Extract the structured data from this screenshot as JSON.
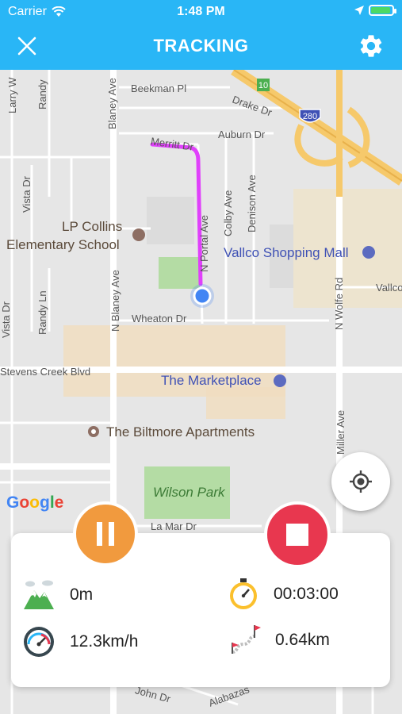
{
  "status": {
    "carrier": "Carrier",
    "time": "1:48 PM"
  },
  "navbar": {
    "title": "TRACKING"
  },
  "map": {
    "labels": {
      "beekman": "Beekman Pl",
      "drake": "Drake Dr",
      "auburn": "Auburn Dr",
      "merritt": "Merritt Dr",
      "lp_collins_1": "LP Collins",
      "lp_collins_2": "Elementary School",
      "vallco_mall": "Vallco Shopping Mall",
      "vallco": "Vallco",
      "wheaton": "Wheaton Dr",
      "stevens_creek": "Stevens Creek Blvd",
      "marketplace": "The Marketplace",
      "biltmore": "The Biltmore Apartments",
      "wilson_park": "Wilson Park",
      "la_mar": "La Mar Dr",
      "john": "John Dr",
      "alabazas": "Alabazas",
      "larry": "Larry W",
      "randy": "Randy",
      "vista": "Vista Dr",
      "randy_ln": "Randy Ln",
      "vista2": "Vista Dr",
      "blaney": "Blaney Ave",
      "n_blaney": "N Blaney Ave",
      "n_portal": "N Portal Ave",
      "colby": "Colby Ave",
      "denison": "Denison Ave",
      "n_wolfe": "N Wolfe Rd",
      "miller": "Miller Ave",
      "hw10": "10",
      "hw280": "280"
    },
    "google": [
      "G",
      "o",
      "o",
      "g",
      "l",
      "e"
    ]
  },
  "controls": {
    "pause": "pause",
    "stop": "stop",
    "locate": "my-location"
  },
  "stats": {
    "altitude": "0m",
    "duration": "00:03:00",
    "speed": "12.3km/h",
    "distance": "0.64km"
  },
  "colors": {
    "accent": "#29b6f6",
    "pause": "#f19a3e",
    "stop": "#e8374f",
    "track": "#e040fb"
  }
}
